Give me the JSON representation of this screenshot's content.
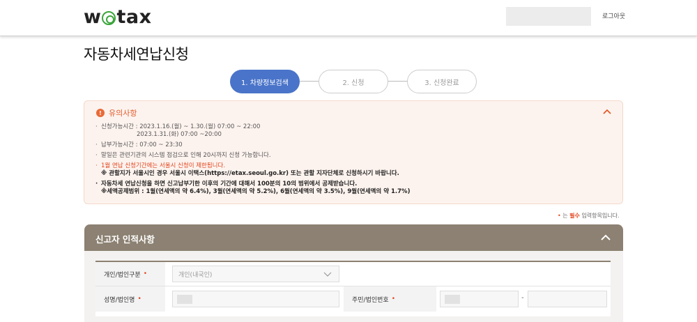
{
  "header": {
    "logo_left": "w",
    "logo_right": "tax",
    "logout_label": "로그아웃"
  },
  "page": {
    "title": "자동차세연납신청"
  },
  "steps": [
    {
      "label": "1. 차량정보검색",
      "active": true
    },
    {
      "label": "2. 신청",
      "active": false
    },
    {
      "label": "3. 신청완료",
      "active": false
    }
  ],
  "notice": {
    "icon": "!",
    "title": "유의사항",
    "items": {
      "apply_period_1": "신청가능시간 : 2023.1.16.(월) ~ 1.30.(월) 07:00 ~ 22:00",
      "apply_period_2": "2023.1.31.(화) 07:00 ~20:00",
      "payment_time": "납부가능시간 : 07:00 ~ 23:30",
      "last_day": "말일은 관련기관의 시스템 점검으로 인해 20시까지 신청 가능합니다.",
      "limit_red": "1월 연납 신청기간에는 서울시 신청이 제한됩니다.",
      "limit_note": "※ 관할지가 서울시인 경우 서울시 이택스(https://etax.seoul.go.kr) 또는 관할 지자단체로 신청하시기 바랍니다.",
      "deduction": "자동차세 연납신청을 하면 신고납부기한 이후의 기간에 대해서 100분의 10의 범위에서 공제받습니다.",
      "deduction_range": "※세액공제범위 : 1월(연세액의 약 6.4%), 3월(연세액의 약 5.2%), 6월(연세액의 약 3.5%), 9월(연세액의 약 1.7%)"
    }
  },
  "required_note": {
    "star": "•",
    "prefix": "는 ",
    "required": "필수",
    "suffix": " 입력항목입니다."
  },
  "form": {
    "section_title": "신고자 인적사항",
    "type_label": "개인/법인구분",
    "type_value": "개인(내국인)",
    "name_label": "성명/법인명",
    "id_label": "주민/법인번호",
    "dash": "-",
    "star": "•"
  },
  "colors": {
    "accent_blue": "#4a74c9",
    "notice_bg": "#fdf3ee",
    "notice_red": "#e1431d",
    "panel_brown": "#8c8172",
    "logo_green": "#3aa53a"
  }
}
